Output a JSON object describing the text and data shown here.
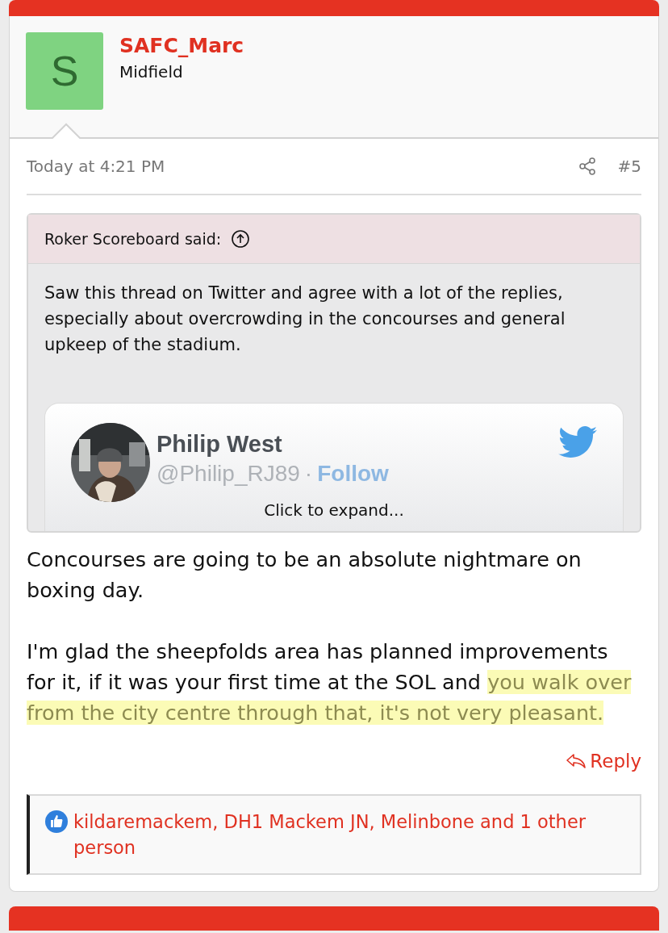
{
  "post": {
    "avatar_letter": "S",
    "author": "SAFC_Marc",
    "user_title": "Midfield",
    "time": "Today at 4:21 PM",
    "number": "#5"
  },
  "quote": {
    "header": "Roker Scoreboard said:",
    "text": "Saw this thread on Twitter and agree with a lot of the replies, especially about overcrowding in the concourses and general upkeep of the stadium.",
    "tweet": {
      "name": "Philip West",
      "handle": "@Philip_RJ89",
      "separator": "·",
      "follow": "Follow"
    },
    "expand": "Click to expand..."
  },
  "body": [
    [
      {
        "text": "Concourses are going to be an absolute nightmare on boxing day.",
        "highlighted": false
      }
    ],
    [
      {
        "text": "I'm glad the sheepfolds area has planned improvements for it, if it was your first time at the SOL and ",
        "highlighted": false
      },
      {
        "text": "you walk over from the city centre through that, it's not very pleasant.",
        "highlighted": true
      }
    ]
  ],
  "reply": "Reply",
  "reactions": "kildaremackem, DH1 Mackem JN, Melinbone and 1 other person"
}
